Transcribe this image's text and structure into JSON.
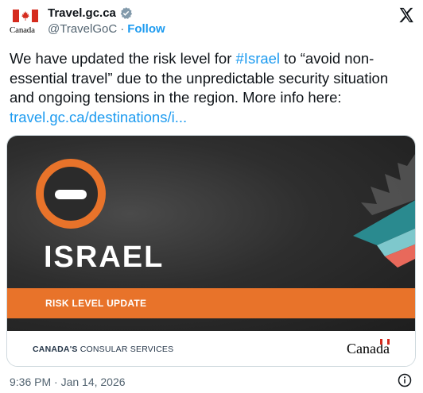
{
  "header": {
    "avatar_wordmark": "Canada",
    "display_name": "Travel.gc.ca",
    "handle": "@TravelGoC",
    "separator": "·",
    "follow_label": "Follow"
  },
  "tweet": {
    "text_before_hashtag": "We have updated the risk level for ",
    "hashtag": "#Israel",
    "text_after_hashtag": " to “avoid non-essential travel” due to the unpredictable security situation and ongoing tensions in the region. More info here: ",
    "link": "travel.gc.ca/destinations/i..."
  },
  "card": {
    "country": "ISRAEL",
    "band_label": "RISK LEVEL UPDATE",
    "footer_left_bold": "CANADA'S",
    "footer_left_rest": " CONSULAR SERVICES",
    "footer_right": "Canada",
    "colors": {
      "accent": "#e8732a",
      "dark": "#2b2b2b",
      "teal": "#2a8a8f",
      "coral": "#e8695b"
    }
  },
  "footer": {
    "timestamp": "9:36 PM · Jan 14, 2026"
  },
  "icons": [
    "verified-badge-icon",
    "x-logo-icon",
    "risk-level-icon",
    "info-icon"
  ]
}
